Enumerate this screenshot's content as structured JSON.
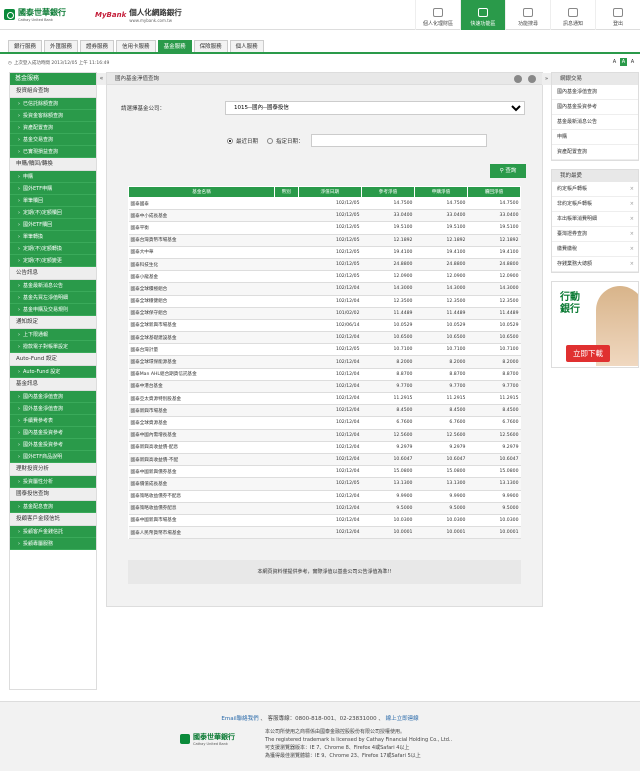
{
  "header": {
    "logo1_title": "國泰世華銀行",
    "logo1_sub": "Cathay United Bank",
    "logo2_brand": "MyBank",
    "logo2_title": "個人化網路銀行",
    "logo2_sub": "www.mybank.com.tw",
    "nav": [
      {
        "label": "個人化理財區",
        "icon": "person-icon"
      },
      {
        "label": "快速功能區",
        "icon": "lightning-icon"
      },
      {
        "label": "功能搜尋",
        "icon": "search-icon"
      },
      {
        "label": "訊息通知",
        "icon": "message-icon"
      },
      {
        "label": "登出",
        "icon": "logout-icon"
      }
    ]
  },
  "tabs": [
    "銀行服務",
    "外匯服務",
    "證券服務",
    "信用卡服務",
    "基金服務",
    "保險服務",
    "個人服務"
  ],
  "active_tab": "基金服務",
  "status": "上次登入成功時間 2013/12/05 上午 11:16:49",
  "font_sizes": [
    "A",
    "A",
    "A"
  ],
  "sidebar": {
    "title": "基金服務",
    "sections": [
      {
        "cat": "投資組合查詢",
        "items": [
          "已信託餘額查詢",
          "投資金客餘額查詢",
          "資產配置查詢",
          "基金交易查詢",
          "已實現損益查詢"
        ]
      },
      {
        "cat": "申購/贖回/轉換",
        "items": [
          "申購",
          "國外ETF申購",
          "單筆贖回",
          "定期(不)定額贖回",
          "國外ETF贖回",
          "單筆轉換",
          "定期(不)定額轉換",
          "定期(不)定額變更"
        ]
      },
      {
        "cat": "公告訊息",
        "items": [
          "基金最新消息公告",
          "基金先買左淨值明細",
          "基金申購及交易規則"
        ]
      },
      {
        "cat": "通知設定",
        "items": [
          "上下限通報",
          "撥款電子對帳單設定"
        ]
      },
      {
        "cat": "Auto-Fund 設定",
        "items": [
          "Auto-Fund 設定"
        ]
      },
      {
        "cat": "基金訊息",
        "items": [
          "國內基金淨值查詢",
          "國外基金淨值查詢",
          "手續費參考表",
          "國內基金投資參考",
          "國外基金投資參考",
          "國外ETF商品說明"
        ]
      },
      {
        "cat": "理財投資分析",
        "items": [
          "投資屬性分析"
        ]
      },
      {
        "cat": "國泰投信查詢",
        "items": [
          "基金配息查詢"
        ]
      },
      {
        "cat": "投顧客戶金錢信託",
        "items": [
          "投顧客戶金錢信託",
          "投顧專屬服務"
        ]
      }
    ]
  },
  "main": {
    "title": "國內基金淨值查詢",
    "company_label": "請選擇基金公司：",
    "company_value": "1015--國內--國泰投信",
    "radio_recent": "最近日期",
    "radio_specific": "指定日期：",
    "query_button": "查詢",
    "columns": [
      "基金名稱",
      "幣別",
      "淨值日期",
      "參考淨值",
      "申購淨值",
      "贖回淨值"
    ],
    "rows": [
      [
        "國泰國泰",
        "",
        "102/12/05",
        "14.7500",
        "14.7500",
        "14.7500"
      ],
      [
        "國泰中小成長基金",
        "",
        "102/12/05",
        "33.0400",
        "33.0400",
        "33.0400"
      ],
      [
        "國泰平衡",
        "",
        "102/12/05",
        "19.5100",
        "19.5100",
        "19.5100"
      ],
      [
        "國泰台灣貨幣市場基金",
        "",
        "102/12/05",
        "12.1892",
        "12.1892",
        "12.1892"
      ],
      [
        "國泰大中華",
        "",
        "102/12/05",
        "19.4100",
        "19.4100",
        "19.4100"
      ],
      [
        "國泰科技生化",
        "",
        "102/12/05",
        "24.8800",
        "24.8800",
        "24.8800"
      ],
      [
        "國泰小龍基金",
        "",
        "102/12/05",
        "12.0900",
        "12.0900",
        "12.0900"
      ],
      [
        "國泰全球積極組合",
        "",
        "102/12/04",
        "14.3000",
        "14.3000",
        "14.3000"
      ],
      [
        "國泰全球穩健組合",
        "",
        "102/12/04",
        "12.3500",
        "12.3500",
        "12.3500"
      ],
      [
        "國泰全球保守組合",
        "",
        "101/02/02",
        "11.4489",
        "11.4489",
        "11.4489"
      ],
      [
        "國泰全球新興市場基金",
        "",
        "102/06/14",
        "10.0529",
        "10.0529",
        "10.0529"
      ],
      [
        "國泰全球基礎建設基金",
        "",
        "102/12/04",
        "10.6500",
        "10.6500",
        "10.6500"
      ],
      [
        "國泰台灣計量",
        "",
        "102/12/05",
        "10.7100",
        "10.7100",
        "10.7100"
      ],
      [
        "國泰全球環保能源基金",
        "",
        "102/12/04",
        "8.2000",
        "8.2000",
        "8.2000"
      ],
      [
        "國泰Man AHL組合期貨信託基金",
        "",
        "102/12/04",
        "8.8700",
        "8.8700",
        "8.8700"
      ],
      [
        "國泰中港台基金",
        "",
        "102/12/04",
        "9.7700",
        "9.7700",
        "9.7700"
      ],
      [
        "國泰亞太資源特別股基金",
        "",
        "102/12/04",
        "11.2915",
        "11.2915",
        "11.2915"
      ],
      [
        "國泰新興市場基金",
        "",
        "102/12/04",
        "8.4500",
        "8.4500",
        "8.4500"
      ],
      [
        "國泰全球資源基金",
        "",
        "102/12/04",
        "6.7600",
        "6.7600",
        "6.7600"
      ],
      [
        "國泰中國內需增長基金",
        "",
        "102/12/04",
        "12.5600",
        "12.5600",
        "12.5600"
      ],
      [
        "國泰新興高收益債-配息",
        "",
        "102/12/04",
        "9.2979",
        "9.2979",
        "9.2979"
      ],
      [
        "國泰新興高收益債-不配",
        "",
        "102/12/04",
        "10.6047",
        "10.6047",
        "10.6047"
      ],
      [
        "國泰中國新興債券基金",
        "",
        "102/12/04",
        "15.0800",
        "15.0800",
        "15.0800"
      ],
      [
        "國泰價值成長基金",
        "",
        "102/12/05",
        "13.1300",
        "13.1300",
        "13.1300"
      ],
      [
        "國泰策略收益債券不配息",
        "",
        "102/12/04",
        "9.9900",
        "9.9900",
        "9.9900"
      ],
      [
        "國泰策略收益債券配息",
        "",
        "102/12/04",
        "9.5000",
        "9.5000",
        "9.5000"
      ],
      [
        "國泰中國新興市場基金",
        "",
        "102/12/04",
        "10.0300",
        "10.0300",
        "10.0300"
      ],
      [
        "國泰人民幣貨幣市場基金",
        "",
        "102/12/04",
        "10.0001",
        "10.0001",
        "10.0001"
      ]
    ],
    "note": "本網頁資料僅提供參考，實際淨值以基金公司公告淨值為準!!"
  },
  "right": {
    "panel1_title": "網銀交易",
    "panel1_items": [
      "國內基金淨值查詢",
      "國內基金投資參考",
      "基金最新消息公告",
      "申購",
      "資產配置查詢"
    ],
    "panel2_title": "我的最愛",
    "panel2_items": [
      "約定帳戶轉帳",
      "非約定帳戶轉帳",
      "本出帳單消費明細",
      "臺灣證券查詢",
      "繳費繳稅",
      "存錢業務大總額"
    ],
    "ad_line1": "行動",
    "ad_line2": "銀行",
    "ad_button": "立即下載"
  },
  "footer": {
    "email_label": "Email聯絡我們",
    "phone": "客服專線：0800-818-001、02-23831000",
    "online": "線上立即連線",
    "logo_title": "國泰世華銀行",
    "logo_sub": "Cathay United Bank",
    "line1": "本公司所使用之商標係由國泰金融控股股份有限公司授權使用。",
    "line2": "The registered trademark is licensed by Cathay Financial Holding Co., Ltd..",
    "line3": "可支援瀏覽器版本：IE 7、Chrome 8、Firefox 4或Safari 4以上",
    "line4": "為獲得最佳瀏覽體驗：IE 9、Chrome 23、Firefox 17或Safari 5以上"
  }
}
